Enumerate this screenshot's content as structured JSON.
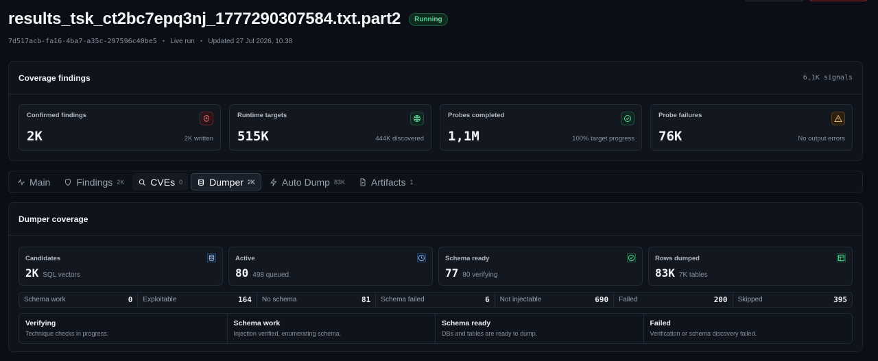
{
  "header": {
    "title": "results_tsk_ct2bc7epq3nj_1777290307584.txt.part2",
    "status_badge": "Running",
    "run_id": "7d517acb-fa16-4ba7-a35c-297596c40be5",
    "run_mode": "Live run",
    "updated": "Updated 27 Jul 2026, 10.38"
  },
  "coverage": {
    "title": "Coverage findings",
    "signals": "6,1K signals",
    "cards": [
      {
        "label": "Confirmed findings",
        "value": "2K",
        "sub": "2K written",
        "icon": "shield-icon",
        "tone": "red"
      },
      {
        "label": "Runtime targets",
        "value": "515K",
        "sub": "444K discovered",
        "icon": "globe-icon",
        "tone": "green"
      },
      {
        "label": "Probes completed",
        "value": "1,1M",
        "sub": "100% target progress",
        "icon": "check-circle-icon",
        "tone": "green"
      },
      {
        "label": "Probe failures",
        "value": "76K",
        "sub": "No output errors",
        "icon": "warning-icon",
        "tone": "amber"
      }
    ]
  },
  "tabs": [
    {
      "label": "Main",
      "count": "",
      "icon": "activity-icon"
    },
    {
      "label": "Findings",
      "count": "2K",
      "icon": "shield-icon"
    },
    {
      "label": "CVEs",
      "count": "0",
      "icon": "search-icon"
    },
    {
      "label": "Dumper",
      "count": "2K",
      "icon": "database-icon"
    },
    {
      "label": "Auto Dump",
      "count": "83K",
      "icon": "bolt-icon"
    },
    {
      "label": "Artifacts",
      "count": "1",
      "icon": "file-icon"
    }
  ],
  "dumper": {
    "title": "Dumper coverage",
    "cards": [
      {
        "label": "Candidates",
        "value": "2K",
        "sub": "SQL vectors",
        "icon": "database-icon",
        "tone": "blue"
      },
      {
        "label": "Active",
        "value": "80",
        "sub": "498 queued",
        "icon": "clock-icon",
        "tone": "blue"
      },
      {
        "label": "Schema ready",
        "value": "77",
        "sub": "80 verifying",
        "icon": "check-circle-icon",
        "tone": "green"
      },
      {
        "label": "Rows dumped",
        "value": "83K",
        "sub": "7K tables",
        "icon": "table-icon",
        "tone": "green"
      }
    ],
    "counts": [
      {
        "label": "Schema work",
        "value": "0"
      },
      {
        "label": "Exploitable",
        "value": "164"
      },
      {
        "label": "No schema",
        "value": "81"
      },
      {
        "label": "Schema failed",
        "value": "6"
      },
      {
        "label": "Not injectable",
        "value": "690"
      },
      {
        "label": "Failed",
        "value": "200"
      },
      {
        "label": "Skipped",
        "value": "395"
      }
    ],
    "legend": [
      {
        "title": "Verifying",
        "desc": "Technique checks in progress."
      },
      {
        "title": "Schema work",
        "desc": "Injection verified, enumerating schema."
      },
      {
        "title": "Schema ready",
        "desc": "DBs and tables are ready to dump."
      },
      {
        "title": "Failed",
        "desc": "Verification or schema discovery failed."
      }
    ]
  }
}
